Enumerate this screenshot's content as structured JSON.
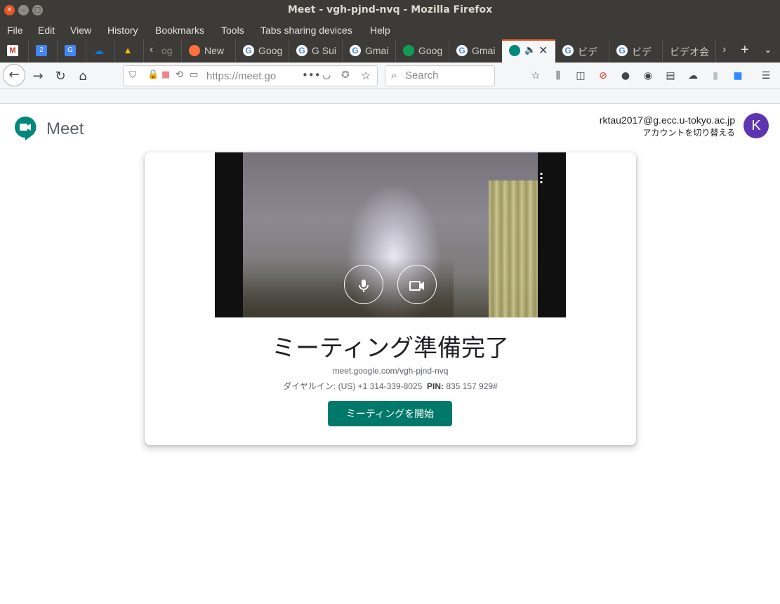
{
  "window": {
    "title": "Meet - vgh-pjnd-nvq - Mozilla Firefox"
  },
  "menu": [
    "File",
    "Edit",
    "View",
    "History",
    "Bookmarks",
    "Tools",
    "Tabs sharing devices",
    "Help"
  ],
  "tabs": [
    {
      "label": "og",
      "icon": "google-icon"
    },
    {
      "label": "New",
      "icon": "firefox-icon"
    },
    {
      "label": "Goog",
      "icon": "google-icon"
    },
    {
      "label": "G Sui",
      "icon": "google-icon"
    },
    {
      "label": "Gmai",
      "icon": "google-icon"
    },
    {
      "label": "Goog",
      "icon": "hangouts-icon"
    },
    {
      "label": "Gmai",
      "icon": "google-icon"
    },
    {
      "label": "",
      "icon": "meet-icon",
      "active": true
    },
    {
      "label": "ビデ",
      "icon": "google-icon"
    },
    {
      "label": "ビデ",
      "icon": "google-icon"
    },
    {
      "label": "ビデオ会",
      "icon": ""
    }
  ],
  "navbar": {
    "url": "https://meet.go",
    "search_placeholder": "Search"
  },
  "page": {
    "brand": "Meet",
    "account_email": "rktau2017@g.ecc.u-tokyo.ac.jp",
    "account_switch": "アカウントを切り替える",
    "avatar_letter": "K",
    "ready_title": "ミーティング準備完了",
    "meeting_url": "meet.google.com/vgh-pjnd-nvq",
    "dialin_label": "ダイヤルイン:",
    "dialin_number": "(US) +1 314-339-8025",
    "pin_label": "PIN:",
    "pin_value": "835 157 929#",
    "start_button": "ミーティングを開始"
  },
  "colors": {
    "accent": "#00796b",
    "avatar": "#5e35b1",
    "tab_highlight": "#e95420"
  }
}
